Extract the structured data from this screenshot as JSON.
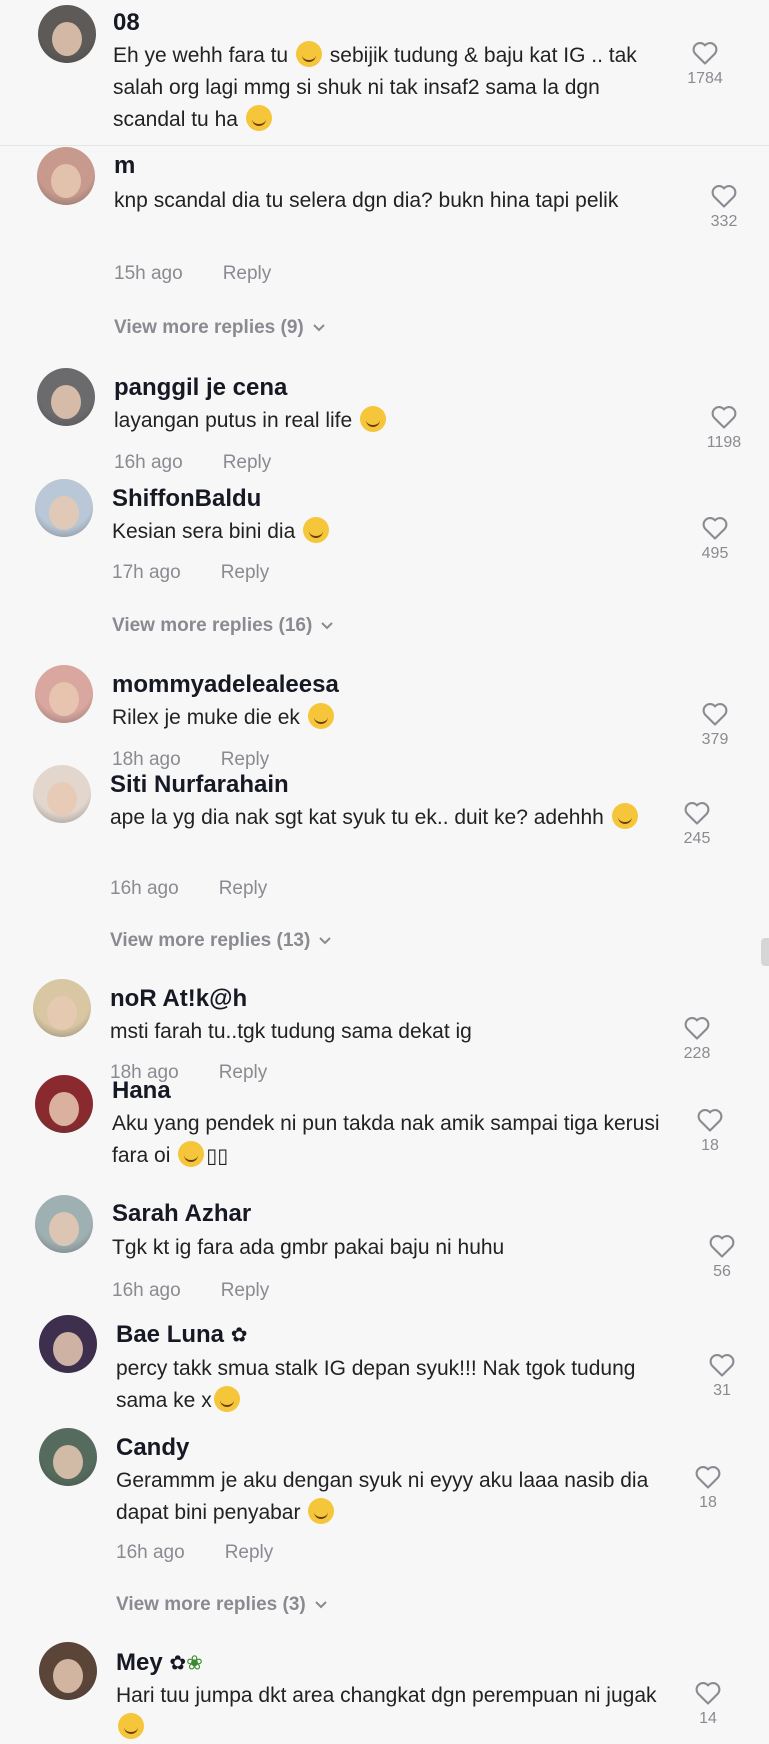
{
  "colors": {
    "background": "#f7f7f8",
    "text": "#161823",
    "muted": "#8a8b91",
    "emoji": "#f5c53a"
  },
  "reply_label": "Reply",
  "comments": [
    {
      "username": "08",
      "text": "Eh ye wehh fara tu",
      "text2": "sebijik tudung & baju kat IG .. tak salah org lagi mmg si shuk ni tak insaf2 sama la dgn scandal tu ha",
      "likes": "1784",
      "avatar_color": "#5d5a58"
    },
    {
      "username": "m",
      "text": "knp scandal dia tu selera dgn dia? bukn hina tapi pelik",
      "time": "15h ago",
      "likes": "332",
      "more": "View more replies (9)",
      "avatar_color": "#c79a8d"
    },
    {
      "username": "panggil je cena",
      "text": "layangan putus in real life",
      "time": "16h ago",
      "likes": "1198",
      "avatar_color": "#6b6b6d"
    },
    {
      "username": "ShiffonBaldu",
      "text": "Kesian sera bini dia",
      "time": "17h ago",
      "likes": "495",
      "more": "View more replies (16)",
      "avatar_color": "#b9c7d6"
    },
    {
      "username": "mommyadelealeesa",
      "text": "Rilex je muke die ek",
      "time": "18h ago",
      "likes": "379",
      "avatar_color": "#d9a7a0"
    },
    {
      "username": "Siti Nurfarahain",
      "text": "ape la yg dia nak sgt kat syuk tu ek.. duit ke? adehhh",
      "time": "16h ago",
      "likes": "245",
      "more": "View more replies (13)",
      "avatar_color": "#e2d6cd"
    },
    {
      "username": "noR At!k@h",
      "text": "msti farah tu..tgk tudung sama dekat ig",
      "time": "18h ago",
      "likes": "228",
      "avatar_color": "#d8c7a2"
    },
    {
      "username": "Hana",
      "text": "Aku yang pendek ni pun takda nak amik sampai tiga kerusi fara oi",
      "likes": "18",
      "avatar_color": "#8a2a2e"
    },
    {
      "username": "Sarah Azhar",
      "text": "Tgk kt ig fara ada gmbr pakai baju ni huhu",
      "time": "16h ago",
      "likes": "56",
      "avatar_color": "#9fb0b3"
    },
    {
      "username": "Bae Luna",
      "text": "percy takk smua stalk IG depan syuk!!! Nak tgok tudung sama ke x",
      "likes": "31",
      "avatar_color": "#3e2f4e"
    },
    {
      "username": "Candy",
      "text": "Gerammm je aku dengan syuk ni eyyy aku laaa nasib dia dapat bini penyabar",
      "time": "16h ago",
      "likes": "18",
      "more": "View more replies (3)",
      "avatar_color": "#556b5d"
    },
    {
      "username": "Mey",
      "text": "Hari tuu jumpa dkt area changkat dgn perempuan ni jugak",
      "likes": "14",
      "avatar_color": "#5b4438"
    }
  ]
}
